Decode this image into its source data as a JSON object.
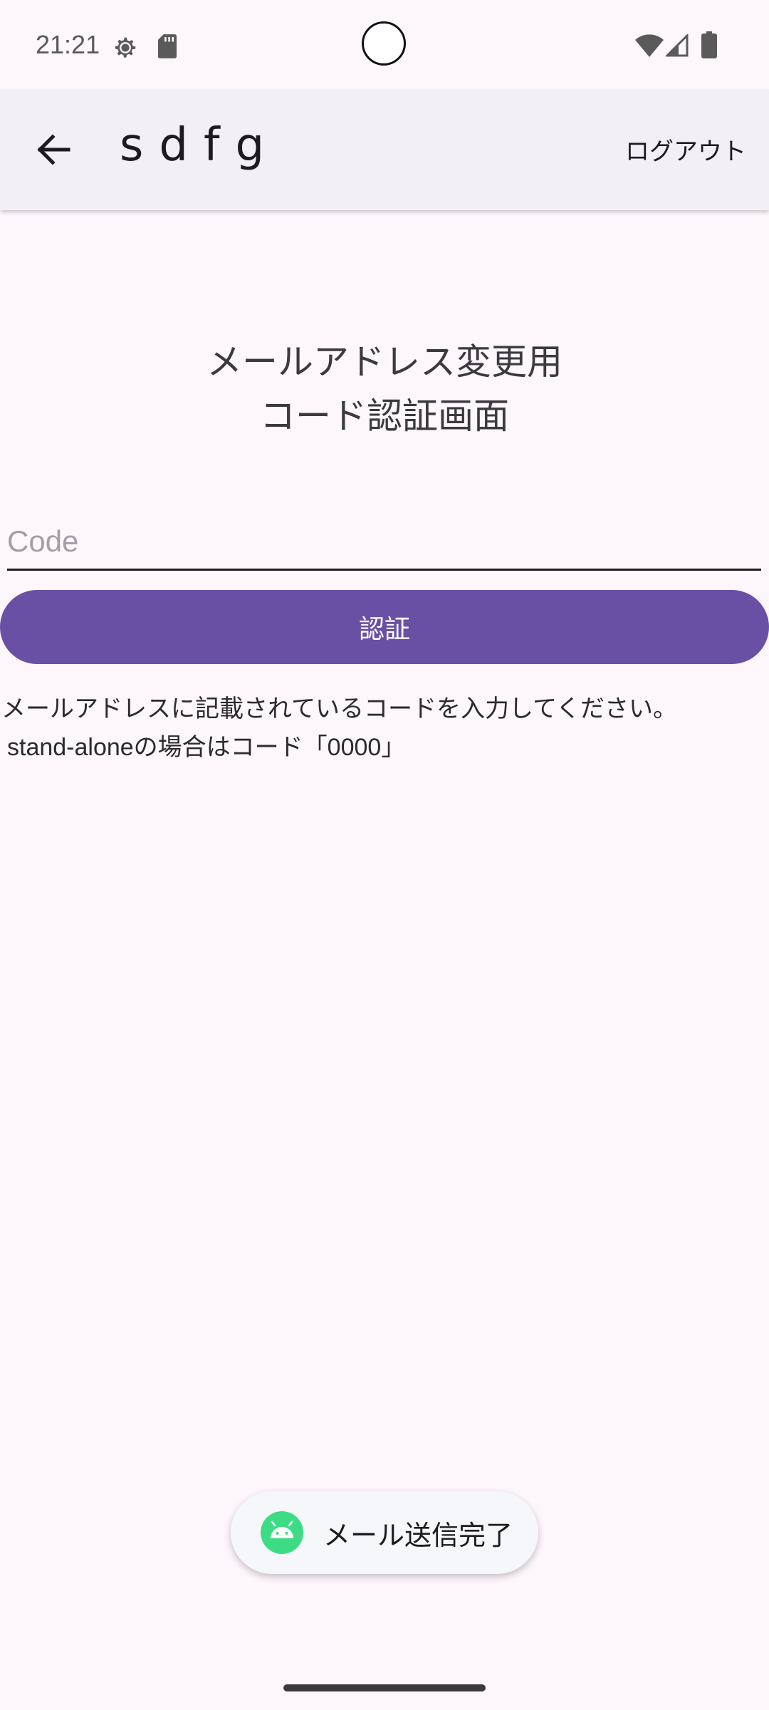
{
  "status_bar": {
    "time": "21:21",
    "icons": [
      "settings-gear-icon",
      "sd-card-icon",
      "wifi-icon",
      "cellular-signal-icon",
      "battery-icon"
    ]
  },
  "app_bar": {
    "back_icon": "arrow-back-icon",
    "title": "sdfg",
    "logout_label": "ログアウト"
  },
  "main": {
    "heading_line1": "メールアドレス変更用",
    "heading_line2": "コード認証画面",
    "code_field": {
      "placeholder": "Code",
      "value": ""
    },
    "verify_label": "認証",
    "instruction_line1": "メールアドレスに記載されているコードを入力してください。",
    "instruction_line2": "stand-aloneの場合はコード「0000」"
  },
  "toast": {
    "icon": "android-icon",
    "text": "メール送信完了"
  },
  "colors": {
    "background": "#fdf6fb",
    "app_bar": "#f3eff6",
    "primary": "#6a50a4"
  }
}
